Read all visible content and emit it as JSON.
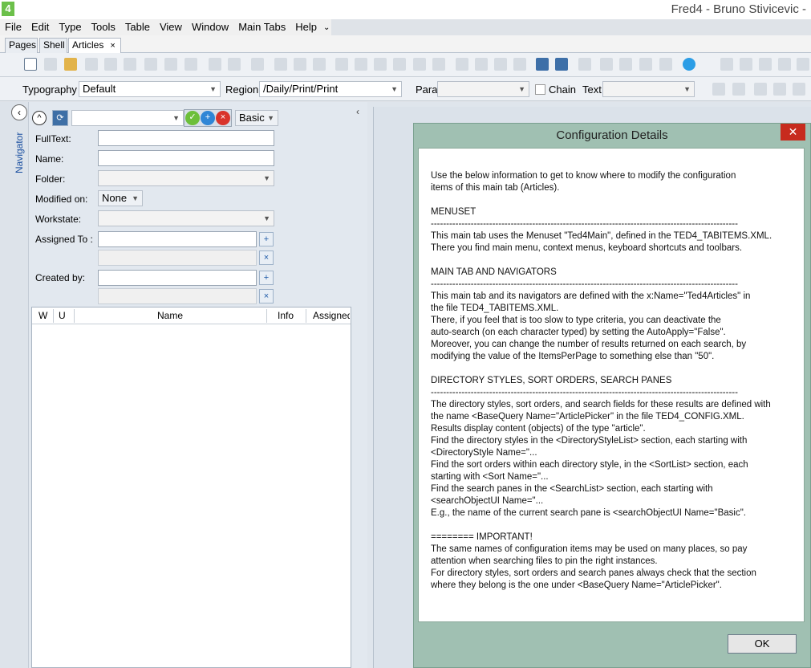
{
  "app": {
    "logo_text": "4",
    "title": "Fred4 - Bruno Stivicevic -"
  },
  "menu": {
    "items": [
      "File",
      "Edit",
      "Type",
      "Tools",
      "Table",
      "View",
      "Window",
      "Main Tabs",
      "Help"
    ],
    "overflow": "⌄"
  },
  "tabs": [
    {
      "label": "Pages"
    },
    {
      "label": "Shell"
    },
    {
      "label": "Articles",
      "close": "×"
    }
  ],
  "toolbar2": {
    "typography_label": "Typography",
    "typography_value": "Default",
    "region_label": "Region",
    "region_value": "/Daily/Print/Print",
    "para_label": "Para",
    "para_value": "",
    "chain_label": "Chain",
    "text_label": "Text",
    "text_value": ""
  },
  "navigator": {
    "rail_label": "Navigator",
    "query_value": "",
    "search_pane": "Basic",
    "fields": {
      "fulltext_label": "FullText:",
      "name_label": "Name:",
      "folder_label": "Folder:",
      "modified_label": "Modified on:",
      "modified_value": "None",
      "workstate_label": "Workstate:",
      "assigned_label": "Assigned To :",
      "created_label": "Created by:"
    },
    "columns": [
      "W",
      "U",
      "Name",
      "Info",
      "Assigned"
    ]
  },
  "dialog": {
    "title": "Configuration Details",
    "close": "✕",
    "body": "Use the below information to get to know where to modify the configuration\nitems of this main tab (Articles).\n\nMENUSET\n----------------------------------------------------------------------------------------------------\nThis main tab uses the Menuset \"Ted4Main\", defined in the TED4_TABITEMS.XML.\nThere you find main menu, context menus, keyboard shortcuts and toolbars.\n\nMAIN TAB AND NAVIGATORS\n----------------------------------------------------------------------------------------------------\nThis main tab and its navigators are defined with the x:Name=\"Ted4Articles\" in\nthe file TED4_TABITEMS.XML.\nThere, if you feel that is too slow to type criteria, you can deactivate the\nauto-search (on each character typed) by setting the AutoApply=\"False\".\nMoreover, you can change the number of results returned on each search, by\nmodifying the value of the ItemsPerPage to something else than \"50\".\n\nDIRECTORY STYLES, SORT ORDERS, SEARCH PANES\n----------------------------------------------------------------------------------------------------\nThe directory styles, sort orders, and search fields for these results are defined with\nthe name <BaseQuery Name=\"ArticlePicker\" in the file TED4_CONFIG.XML.\nResults display content (objects) of the type \"article\".\nFind the directory styles in the <DirectoryStyleList> section, each starting with\n<DirectoryStyle Name=\"...\nFind the sort orders within each directory style, in the <SortList> section, each\nstarting with <Sort Name=\"...\nFind the search panes in the <SearchList> section, each starting with\n<searchObjectUI Name=\"...\nE.g., the name of the current search pane is <searchObjectUI Name=\"Basic\".\n\n======== IMPORTANT!\nThe same names of configuration items may be used on many places, so pay\nattention when searching files to pin the right instances.\nFor directory styles, sort orders and search panes always check that the section\nwhere they belong is the one under <BaseQuery Name=\"ArticlePicker\".",
    "ok_label": "OK"
  }
}
